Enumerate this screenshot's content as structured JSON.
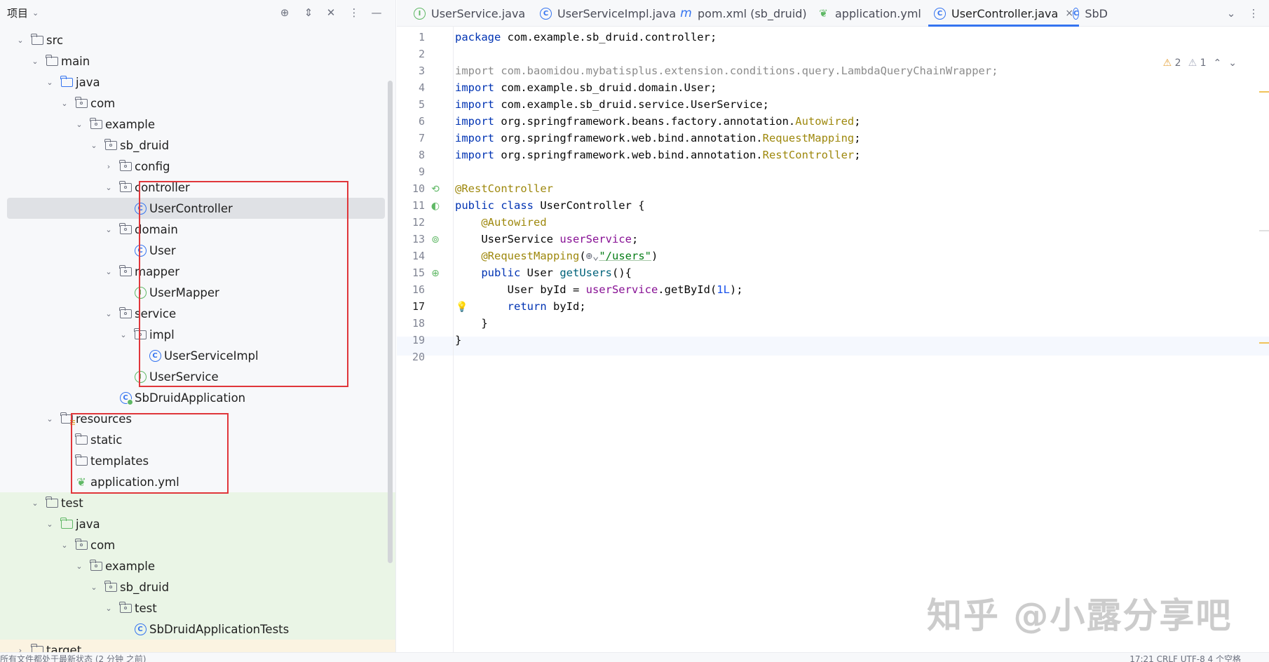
{
  "panel": {
    "title": "项目",
    "icons": [
      "locate-icon",
      "expand-all-icon",
      "collapse-all-icon",
      "more-options-icon",
      "minimize-icon"
    ]
  },
  "tree": [
    {
      "label": "src",
      "kind": "folder",
      "level": 2,
      "expanded": true
    },
    {
      "label": "main",
      "kind": "folder",
      "level": 3,
      "expanded": true
    },
    {
      "label": "java",
      "kind": "source-folder",
      "level": 4,
      "expanded": true
    },
    {
      "label": "com",
      "kind": "package",
      "level": 5,
      "expanded": true
    },
    {
      "label": "example",
      "kind": "package",
      "level": 6,
      "expanded": true
    },
    {
      "label": "sb_druid",
      "kind": "package",
      "level": 7,
      "expanded": true
    },
    {
      "label": "config",
      "kind": "package",
      "level": 8,
      "expanded": false
    },
    {
      "label": "controller",
      "kind": "package",
      "level": 8,
      "expanded": true
    },
    {
      "label": "UserController",
      "kind": "class",
      "level": 9,
      "selected": true
    },
    {
      "label": "domain",
      "kind": "package",
      "level": 8,
      "expanded": true
    },
    {
      "label": "User",
      "kind": "class",
      "level": 9
    },
    {
      "label": "mapper",
      "kind": "package",
      "level": 8,
      "expanded": true
    },
    {
      "label": "UserMapper",
      "kind": "interface",
      "level": 9
    },
    {
      "label": "service",
      "kind": "package",
      "level": 8,
      "expanded": true
    },
    {
      "label": "impl",
      "kind": "package",
      "level": 9,
      "expanded": true
    },
    {
      "label": "UserServiceImpl",
      "kind": "class",
      "level": 10
    },
    {
      "label": "UserService",
      "kind": "interface",
      "level": 9
    },
    {
      "label": "SbDruidApplication",
      "kind": "spring-app",
      "level": 8
    },
    {
      "label": "resources",
      "kind": "resources-folder",
      "level": 4,
      "expanded": true
    },
    {
      "label": "static",
      "kind": "folder",
      "level": 5
    },
    {
      "label": "templates",
      "kind": "folder",
      "level": 5
    },
    {
      "label": "application.yml",
      "kind": "yml",
      "level": 5
    },
    {
      "label": "test",
      "kind": "folder",
      "level": 3,
      "expanded": true,
      "tint": "test"
    },
    {
      "label": "java",
      "kind": "test-folder",
      "level": 4,
      "expanded": true,
      "tint": "test"
    },
    {
      "label": "com",
      "kind": "package",
      "level": 5,
      "expanded": true,
      "tint": "test"
    },
    {
      "label": "example",
      "kind": "package",
      "level": 6,
      "expanded": true,
      "tint": "test"
    },
    {
      "label": "sb_druid",
      "kind": "package",
      "level": 7,
      "expanded": true,
      "tint": "test"
    },
    {
      "label": "test",
      "kind": "package",
      "level": 8,
      "expanded": true,
      "tint": "test"
    },
    {
      "label": "SbDruidApplicationTests",
      "kind": "class",
      "level": 9,
      "tint": "test"
    },
    {
      "label": "target",
      "kind": "folder",
      "level": 2,
      "expanded": false,
      "tint": "target"
    }
  ],
  "tabs": [
    {
      "label": "UserService.java",
      "icon": "interface-icon",
      "active": false
    },
    {
      "label": "UserServiceImpl.java",
      "icon": "class-icon",
      "active": false
    },
    {
      "label": "pom.xml (sb_druid)",
      "icon": "maven-icon",
      "active": false
    },
    {
      "label": "application.yml",
      "icon": "yml-icon",
      "active": false
    },
    {
      "label": "UserController.java",
      "icon": "class-icon",
      "active": true
    },
    {
      "label": "SbD",
      "icon": "spring-app-icon",
      "active": false
    }
  ],
  "inspections": {
    "warnings": "2",
    "weak_warnings": "1"
  },
  "editor": {
    "current_line": 17,
    "line_numbers": [
      "1",
      "2",
      "3",
      "4",
      "5",
      "6",
      "7",
      "8",
      "9",
      "10",
      "11",
      "12",
      "13",
      "14",
      "15",
      "16",
      "17",
      "18",
      "19",
      "20"
    ],
    "lines": [
      [
        {
          "t": "package",
          "c": "kw"
        },
        {
          "t": " com.example.sb_druid.controller;"
        }
      ],
      [],
      [
        {
          "t": "import com.baomidou.mybatisplus.extension.conditions.query.LambdaQueryChainWrapper;",
          "c": "imp-dim"
        }
      ],
      [
        {
          "t": "import",
          "c": "kw"
        },
        {
          "t": " com.example.sb_druid.domain.User;"
        }
      ],
      [
        {
          "t": "import",
          "c": "kw"
        },
        {
          "t": " com.example.sb_druid.service.UserService;"
        }
      ],
      [
        {
          "t": "import",
          "c": "kw"
        },
        {
          "t": " org.springframework.beans.factory.annotation."
        },
        {
          "t": "Autowired",
          "c": "ann"
        },
        {
          "t": ";"
        }
      ],
      [
        {
          "t": "import",
          "c": "kw"
        },
        {
          "t": " org.springframework.web.bind.annotation."
        },
        {
          "t": "RequestMapping",
          "c": "ann"
        },
        {
          "t": ";"
        }
      ],
      [
        {
          "t": "import",
          "c": "kw"
        },
        {
          "t": " org.springframework.web.bind.annotation."
        },
        {
          "t": "RestController",
          "c": "ann"
        },
        {
          "t": ";"
        }
      ],
      [],
      [
        {
          "t": "@RestController",
          "c": "ann"
        }
      ],
      [
        {
          "t": "public class",
          "c": "kw"
        },
        {
          "t": " UserController {"
        }
      ],
      [
        {
          "t": "    "
        },
        {
          "t": "@Autowired",
          "c": "ann"
        }
      ],
      [
        {
          "t": "    UserService "
        },
        {
          "t": "userService",
          "c": "fld"
        },
        {
          "t": ";"
        }
      ],
      [
        {
          "t": "    "
        },
        {
          "t": "@RequestMapping",
          "c": "ann"
        },
        {
          "t": "("
        },
        {
          "t": "⊕⌄",
          "c": "meta"
        },
        {
          "t": "\"/users\"",
          "c": "str"
        },
        {
          "t": ")"
        }
      ],
      [
        {
          "t": "    "
        },
        {
          "t": "public",
          "c": "kw"
        },
        {
          "t": " User "
        },
        {
          "t": "getUsers",
          "c": "mth"
        },
        {
          "t": "(){"
        }
      ],
      [
        {
          "t": "        User byId = "
        },
        {
          "t": "userService",
          "c": "fld"
        },
        {
          "t": ".getById("
        },
        {
          "t": "1L",
          "c": "num"
        },
        {
          "t": ");"
        }
      ],
      [
        {
          "t": "        "
        },
        {
          "t": "return",
          "c": "kw"
        },
        {
          "t": " byId;"
        }
      ],
      [
        {
          "t": "    }"
        }
      ],
      [
        {
          "t": "}"
        }
      ],
      []
    ]
  },
  "status": {
    "left": "所有文件都处于最新状态 (2 分钟 之前)",
    "right": "17:21  CRLF  UTF-8  4 个空格"
  },
  "watermark": "知乎 @小露分享吧",
  "colors": {
    "accent": "#3574f0",
    "highlight_box": "#e0363a",
    "annotation": "#9e880d",
    "keyword": "#0033b3"
  }
}
